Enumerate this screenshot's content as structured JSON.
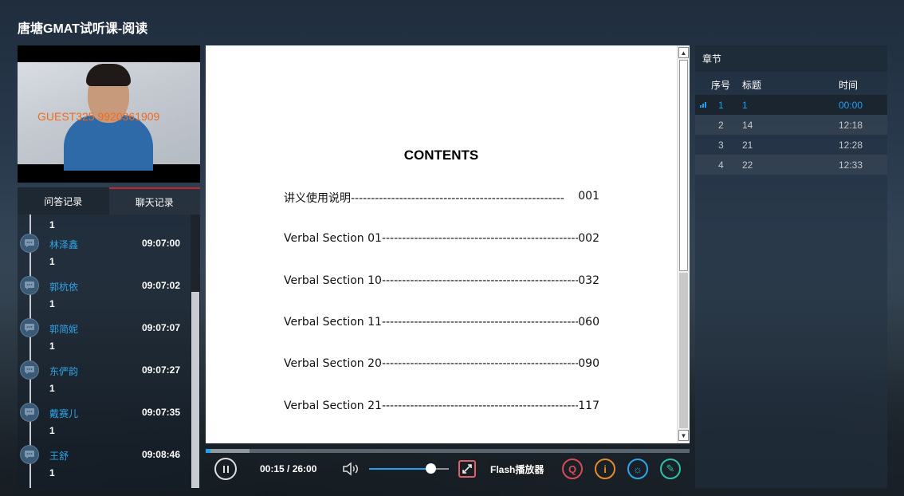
{
  "page": {
    "title": "唐塘GMAT试听课-阅读"
  },
  "video": {
    "watermark": "GUEST325 9920361909"
  },
  "qa": {
    "tabs": [
      {
        "label": "问答记录"
      },
      {
        "label": "聊天记录"
      }
    ],
    "partial_top_value": "1",
    "items": [
      {
        "name": "林泽鑫",
        "time": "09:07:00",
        "value": "1"
      },
      {
        "name": "郭杭依",
        "time": "09:07:02",
        "value": "1"
      },
      {
        "name": "郭简妮",
        "time": "09:07:07",
        "value": "1"
      },
      {
        "name": "东俨韵",
        "time": "09:07:27",
        "value": "1"
      },
      {
        "name": "戴赛儿",
        "time": "09:07:35",
        "value": "1"
      },
      {
        "name": "王舒",
        "time": "09:08:46",
        "value": "1"
      }
    ]
  },
  "document": {
    "title": "CONTENTS",
    "toc": [
      {
        "label": "讲义使用说明",
        "dashes": "-----------------------------------------------------",
        "page": "001"
      },
      {
        "label": "Verbal Section 01",
        "dashes": "-----------------------------------------------------",
        "page": "002"
      },
      {
        "label": "Verbal Section 10",
        "dashes": "-----------------------------------------------------",
        "page": "032"
      },
      {
        "label": "Verbal Section 11",
        "dashes": "-----------------------------------------------------",
        "page": "060"
      },
      {
        "label": "Verbal Section 20",
        "dashes": "-----------------------------------------------------",
        "page": "090"
      },
      {
        "label": "Verbal Section 21",
        "dashes": "-----------------------------------------------------",
        "page": "117"
      }
    ]
  },
  "player": {
    "timecode": "00:15 / 26:00",
    "progress_fraction": 0.01,
    "volume_fraction": 0.77,
    "flash_label": "Flash播放器",
    "qa_icon_glyph": "Q",
    "info_icon_glyph": "i",
    "light_icon_glyph": "☼",
    "pen_icon_glyph": "✎"
  },
  "chapters": {
    "header": "章节",
    "columns": {
      "index": "序号",
      "title": "标题",
      "time": "时间"
    },
    "rows": [
      {
        "index": "1",
        "title": "1",
        "time": "00:00"
      },
      {
        "index": "2",
        "title": "14",
        "time": "12:18"
      },
      {
        "index": "3",
        "title": "21",
        "time": "12:28"
      },
      {
        "index": "4",
        "title": "22",
        "time": "12:33"
      }
    ]
  },
  "colors": {
    "accent_blue": "#1da1f2",
    "watermark_orange": "#f06a1e",
    "chat_tab_red": "#c0282e"
  },
  "icons": [
    "user-icon",
    "pause-icon",
    "volume-icon",
    "fullscreen-icon",
    "qa-icon",
    "info-icon",
    "light-icon",
    "pen-icon",
    "playing-icon",
    "scroll-up-icon",
    "scroll-down-icon"
  ]
}
